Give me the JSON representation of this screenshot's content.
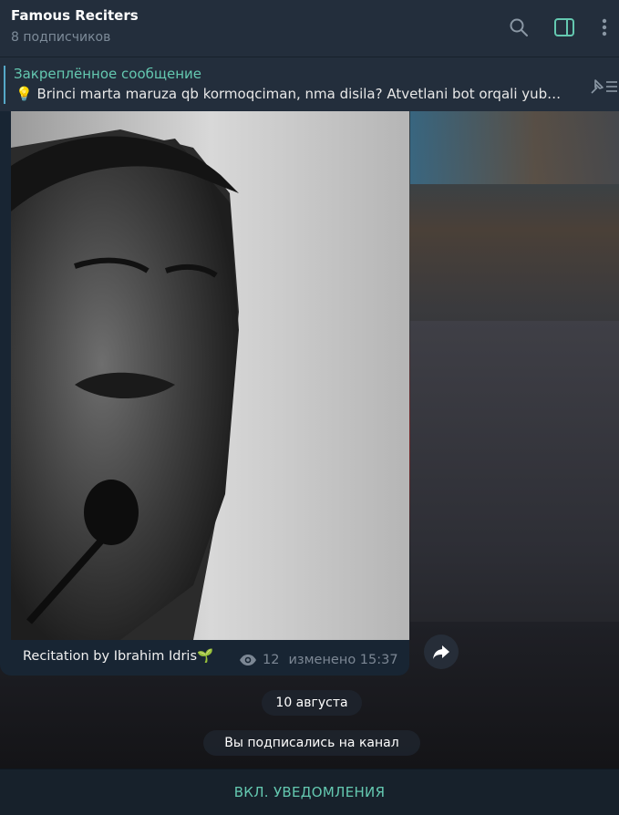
{
  "header": {
    "channel_name": "Famous Reciters",
    "subscribers": "8 подписчиков",
    "icons": [
      "search-icon",
      "sidebar-toggle-icon",
      "more-vertical-icon"
    ]
  },
  "pinned": {
    "label": "Закреплённое сообщение",
    "text": "💡 Brinci marta maruza qb kormoqciman, nma disila? Atvetlani bot orqali yub…",
    "icon": "pin-list-icon"
  },
  "message": {
    "caption": "Recitation by Ibrahim Idris🌱",
    "views": "12",
    "edited": "изменено 15:37",
    "share_icon": "share-icon"
  },
  "service": {
    "date": "10 августа",
    "joined": "Вы подписались на канал"
  },
  "footer": {
    "notifications_label": "ВКЛ. УВЕДОМЛЕНИЯ"
  },
  "colors": {
    "accent": "#64c8b0",
    "header_bg": "#232e3c",
    "bubble_bg": "#182533",
    "muted": "#7d8b99"
  }
}
